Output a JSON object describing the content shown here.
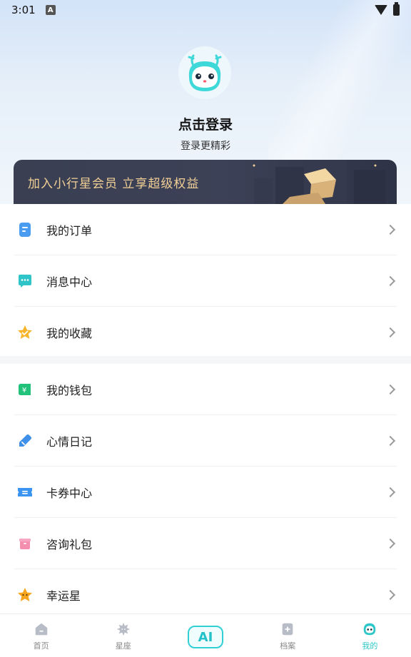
{
  "status_bar": {
    "time": "3:01",
    "notification_icon": "A"
  },
  "profile": {
    "title": "点击登录",
    "subtitle": "登录更精彩"
  },
  "vip_banner": {
    "text": "加入小行星会员 立享超级权益"
  },
  "menu_group_1": [
    {
      "label": "我的订单",
      "icon": "order-icon",
      "color": "#4a9cf0"
    },
    {
      "label": "消息中心",
      "icon": "message-icon",
      "color": "#2fc4c8"
    },
    {
      "label": "我的收藏",
      "icon": "favorite-icon",
      "color": "#f6b52a"
    }
  ],
  "menu_group_2": [
    {
      "label": "我的钱包",
      "icon": "wallet-icon",
      "color": "#22c27a"
    },
    {
      "label": "心情日记",
      "icon": "diary-icon",
      "color": "#3d8fe8"
    },
    {
      "label": "卡券中心",
      "icon": "coupon-icon",
      "color": "#3b95f0"
    },
    {
      "label": "咨询礼包",
      "icon": "gift-icon",
      "color": "#f58fb0"
    },
    {
      "label": "幸运星",
      "icon": "lucky-star-icon",
      "color": "#f7a51e"
    }
  ],
  "tabbar": {
    "items": [
      {
        "label": "首页",
        "icon": "home-icon"
      },
      {
        "label": "星座",
        "icon": "constellation-icon"
      },
      {
        "label": "AI",
        "icon": "ai-icon"
      },
      {
        "label": "档案",
        "icon": "archive-icon"
      },
      {
        "label": "我的",
        "icon": "profile-icon"
      }
    ],
    "active": "我的",
    "active_color": "#2ec7c9"
  }
}
